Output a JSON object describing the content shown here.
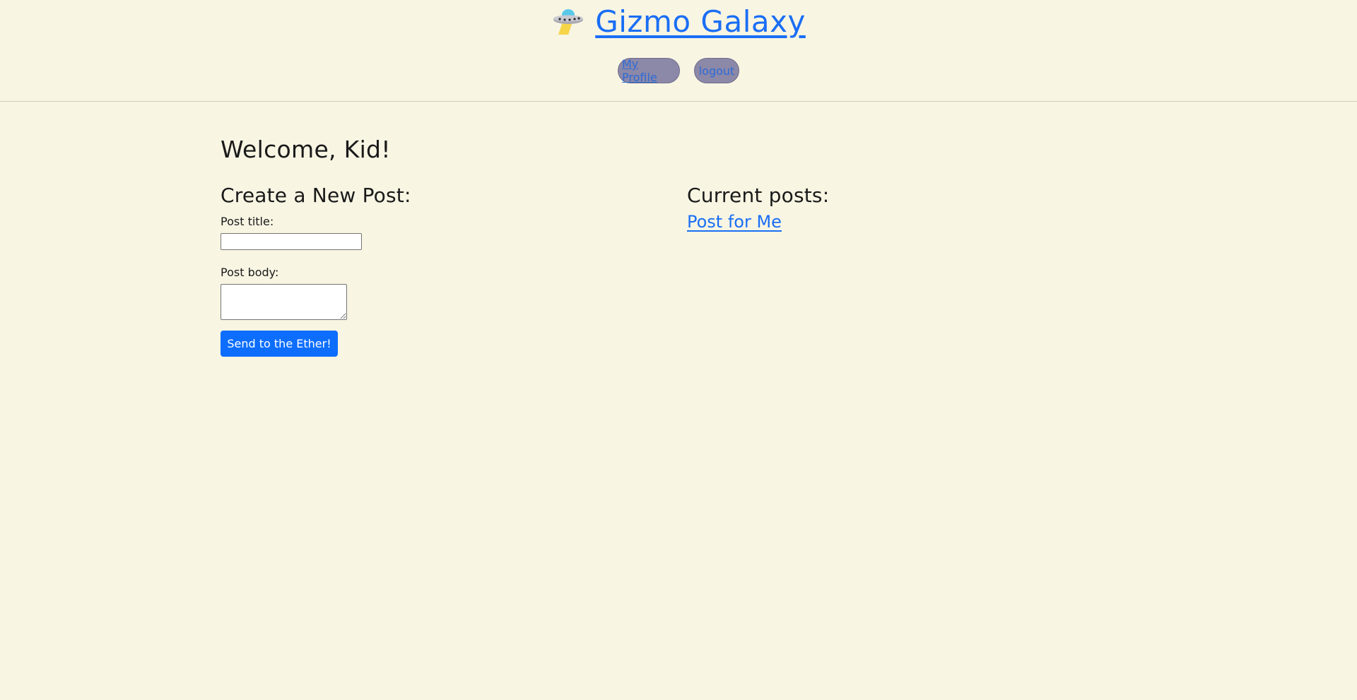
{
  "header": {
    "brand_icon": "ufo-icon",
    "brand_title": "Gizmo Galaxy",
    "nav": {
      "profile_label": "My Profile",
      "logout_label": "logout"
    }
  },
  "main": {
    "welcome": "Welcome, Kid!",
    "create": {
      "heading": "Create a New Post:",
      "title_label": "Post title:",
      "title_value": "",
      "body_label": "Post body:",
      "body_value": "",
      "submit_label": "Send to the Ether!"
    },
    "posts": {
      "heading": "Current posts:",
      "items": [
        {
          "title": "Post for Me"
        }
      ]
    }
  },
  "colors": {
    "background": "#f8f5e3",
    "link": "#1a6ef5",
    "button": "#0d6efd",
    "pill": "#8b88a8"
  }
}
